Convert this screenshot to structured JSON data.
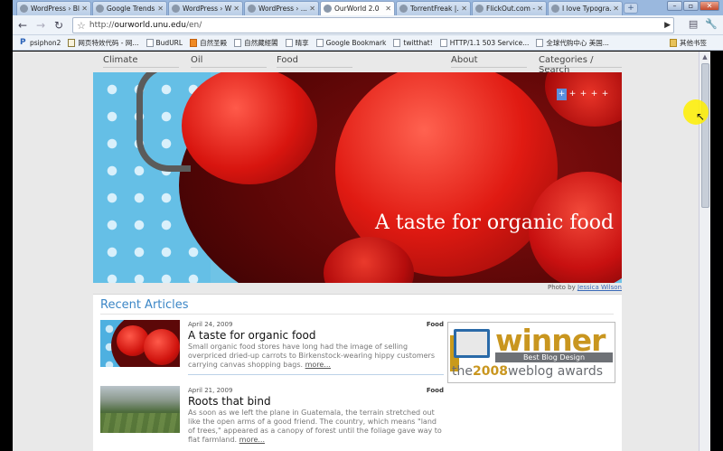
{
  "browser": {
    "tabs": [
      {
        "label": "WordPress › Bl...",
        "active": false
      },
      {
        "label": "Google Trends...",
        "active": false
      },
      {
        "label": "WordPress › W...",
        "active": false
      },
      {
        "label": "WordPress › ...",
        "active": false
      },
      {
        "label": "OurWorld 2.0",
        "active": true
      },
      {
        "label": "TorrentFreak |...",
        "active": false
      },
      {
        "label": "FlickOut.com -...",
        "active": false
      },
      {
        "label": "I love Typogra...",
        "active": false
      }
    ],
    "new_tab_label": "+",
    "url_prefix": "http://",
    "url_host": "ourworld.unu.edu",
    "url_path": "/en/",
    "bookmarks": [
      {
        "label": "psiphon2",
        "icon": "p"
      },
      {
        "label": "网页特效代码 - 网...",
        "icon": "mail"
      },
      {
        "label": "BudURL",
        "icon": "page"
      },
      {
        "label": "自然圣殿",
        "icon": "rss"
      },
      {
        "label": "自然藏經閣",
        "icon": "page"
      },
      {
        "label": "晴享",
        "icon": "page"
      },
      {
        "label": "Google Bookmark",
        "icon": "page"
      },
      {
        "label": "twitthat!",
        "icon": "page"
      },
      {
        "label": "HTTP/1.1 503 Service...",
        "icon": "page"
      },
      {
        "label": "全球代购中心 美国...",
        "icon": "page"
      }
    ],
    "other_bookmarks": "其他书签"
  },
  "nav": {
    "climate": "Climate",
    "oil": "Oil",
    "food": "Food",
    "about": "About",
    "categories": "Categories / Search"
  },
  "hero": {
    "title": "A taste for organic food",
    "slides": [
      "+",
      "+",
      "+",
      "+",
      "+"
    ],
    "photo_credit_prefix": "Photo by",
    "photo_credit_name": "Jessica Wilson"
  },
  "recent": {
    "title": "Recent Articles",
    "more_label": "more...",
    "articles": [
      {
        "date": "April 24, 2009",
        "category": "Food",
        "title": "A taste for organic food",
        "excerpt": "Small organic food stores have long had the image of selling overpriced dried-up carrots to Birkenstock-wearing hippy customers carrying canvas shopping bags."
      },
      {
        "date": "April 21, 2009",
        "category": "Food",
        "title": "Roots that bind",
        "excerpt": "As soon as we left the plane in Guatemala, the terrain stretched out like the open arms of a good friend. The country, which means \"land of trees,\" appeared as a canopy of forest until the foliage gave way to flat farmland."
      }
    ]
  },
  "award": {
    "word": "winner",
    "subtitle": "Best Blog Design",
    "prefix": "the",
    "year": "2008",
    "suffix": "weblog awards"
  }
}
